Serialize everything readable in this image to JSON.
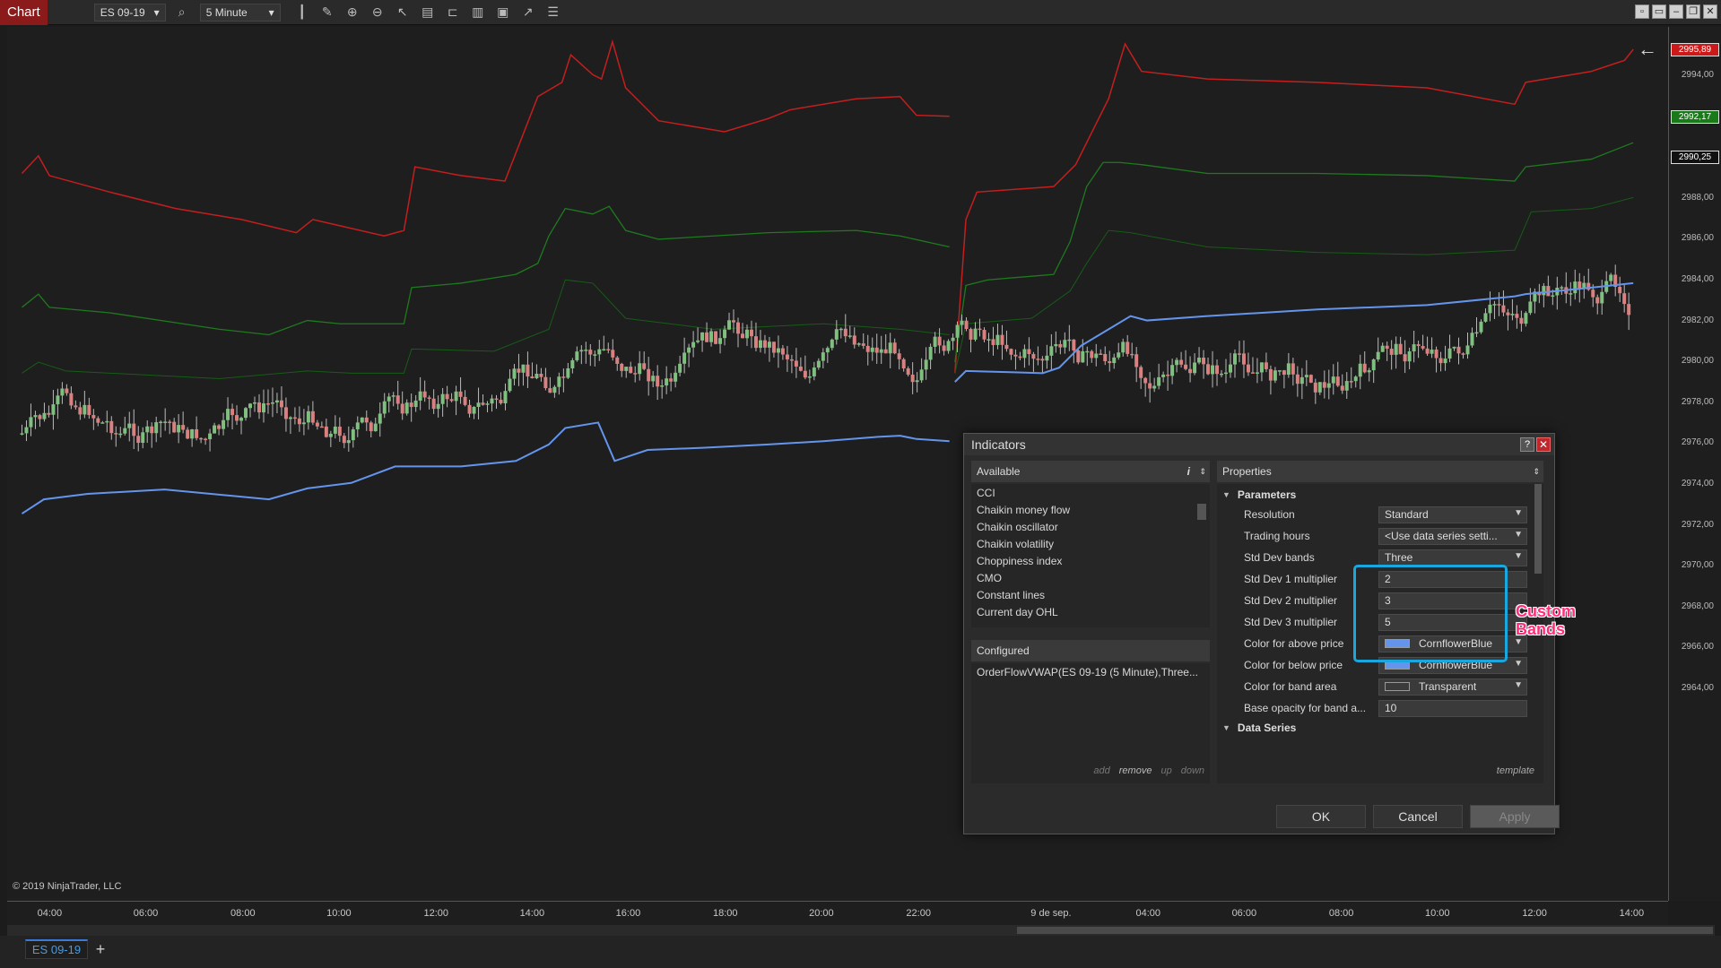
{
  "toolbar": {
    "tab_label": "Chart",
    "instrument": "ES 09-19",
    "interval": "5 Minute"
  },
  "chart": {
    "copyright": "© 2019 NinjaTrader, LLC",
    "price_labels": [
      "2994,00",
      "2992,00",
      "2990,00",
      "2988,00",
      "2986,00",
      "2984,00",
      "2982,00",
      "2980,00",
      "2978,00",
      "2976,00",
      "2974,00",
      "2972,00",
      "2970,00",
      "2968,00",
      "2966,00",
      "2964,00"
    ],
    "price_tags": [
      {
        "text": "2995,89",
        "color": "#cc1a1a"
      },
      {
        "text": "2992,17",
        "color": "#1a7a1a"
      },
      {
        "text": "2990,25",
        "color": "#111111"
      }
    ],
    "time_labels": [
      "04:00",
      "06:00",
      "08:00",
      "10:00",
      "12:00",
      "14:00",
      "16:00",
      "18:00",
      "20:00",
      "22:00",
      "9 de sep.",
      "04:00",
      "06:00",
      "08:00",
      "10:00",
      "12:00",
      "14:00"
    ],
    "colors": {
      "upper_band": "#c41e1e",
      "mid_bands": "#1f7a1f",
      "vwap": "#6495ed",
      "up_candle": "#7fbf7f",
      "down_candle": "#d98080"
    }
  },
  "series_tab": "ES 09-19",
  "dialog": {
    "title": "Indicators",
    "help": "?",
    "available_header": "Available",
    "info_icon": "i",
    "available_items": [
      "CCI",
      "Chaikin money flow",
      "Chaikin oscillator",
      "Chaikin volatility",
      "Choppiness index",
      "CMO",
      "Constant lines",
      "Current day OHL"
    ],
    "configured_header": "Configured",
    "configured_items": [
      "OrderFlowVWAP(ES 09-19 (5 Minute),Three..."
    ],
    "actions": {
      "add": "add",
      "remove": "remove",
      "up": "up",
      "down": "down"
    },
    "properties_header": "Properties",
    "parameters_header": "Parameters",
    "properties": [
      {
        "label": "Resolution",
        "value": "Standard"
      },
      {
        "label": "Trading hours",
        "value": "<Use data series setti..."
      },
      {
        "label": "Std Dev bands",
        "value": "Three"
      },
      {
        "label": "Std Dev 1 multiplier",
        "value": "2"
      },
      {
        "label": "Std Dev 2 multiplier",
        "value": "3"
      },
      {
        "label": "Std Dev 3 multiplier",
        "value": "5"
      },
      {
        "label": "Color for above price",
        "value": "CornflowerBlue",
        "swatch": "#6495ed"
      },
      {
        "label": "Color for below price",
        "value": "CornflowerBlue",
        "swatch": "#6495ed"
      },
      {
        "label": "Color for band area",
        "value": "Transparent",
        "swatch": "transparent"
      },
      {
        "label": "Base opacity for band a...",
        "value": "10"
      }
    ],
    "data_series_header": "Data Series",
    "template": "template",
    "ok": "OK",
    "cancel": "Cancel",
    "apply": "Apply"
  },
  "annotation": {
    "line1": "Custom",
    "line2": "Bands"
  }
}
